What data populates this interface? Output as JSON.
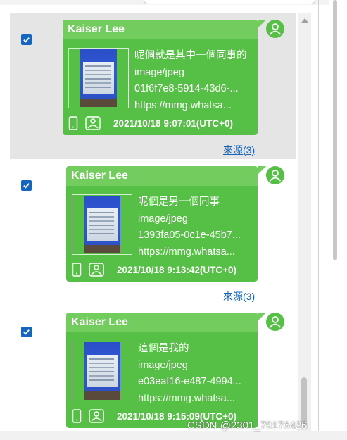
{
  "messages": [
    {
      "sender": "Kaiser Lee",
      "caption": "呢個就是其中一個同事的",
      "mime": "image/jpeg",
      "file_id": "01f6f7e8-5914-43d6-...",
      "url": "https://mmg.whatsa...",
      "timestamp": "2021/10/18 9:07:01(UTC+0)",
      "source_link": "來源(3)",
      "checked": true,
      "selected": true
    },
    {
      "sender": "Kaiser Lee",
      "caption": "呢個是另一個同事",
      "mime": "image/jpeg",
      "file_id": "1393fa05-0c1e-45b7...",
      "url": "https://mmg.whatsa...",
      "timestamp": "2021/10/18 9:13:42(UTC+0)",
      "source_link": "來源(3)",
      "checked": true,
      "selected": false
    },
    {
      "sender": "Kaiser Lee",
      "caption": "這個是我的",
      "mime": "image/jpeg",
      "file_id": "e03eaf16-e487-4994...",
      "url": "https://mmg.whatsa...",
      "timestamp": "2021/10/18 9:15:09(UTC+0)",
      "source_link": "",
      "checked": true,
      "selected": false
    }
  ],
  "watermark": "CSDN @2301_79176426",
  "colors": {
    "bubble": "#56bf45",
    "bubble_header": "#72cc5e",
    "checkbox": "#1565c0",
    "link": "#1565c0",
    "selected_row": "#e5e5e5"
  }
}
